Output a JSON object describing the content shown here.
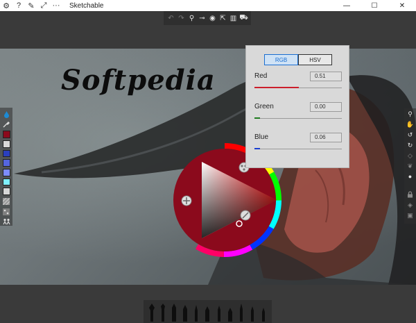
{
  "window": {
    "title": "Sketchable",
    "controls": {
      "minimize": "—",
      "maximize": "☐",
      "close": "✕"
    }
  },
  "titlebar_icons": [
    "settings-icon",
    "help-icon",
    "tools-icon",
    "expand-icon",
    "more-icon"
  ],
  "titlebar_glyphs": {
    "settings": "⚙",
    "help": "?",
    "tools": "✎",
    "expand": "⤢",
    "more": "···"
  },
  "top_toolbar": {
    "icons": [
      "undo-icon",
      "redo-icon",
      "dropper-icon",
      "ruler-icon",
      "eye-icon",
      "export-icon",
      "book-icon",
      "cart-icon"
    ],
    "glyphs": {
      "undo": "↶",
      "redo": "↷",
      "dropper": "⚲",
      "ruler": "⊸",
      "eye": "◉",
      "export": "⇱",
      "book": "▥",
      "cart": "⛟"
    }
  },
  "canvas": {
    "watermark_text": "Softpedia"
  },
  "left_toolbar": {
    "swatches": [
      "#8b0a1c",
      "#d9d9d9",
      "#2a3fbf",
      "#5566e0",
      "#7d8dff",
      "#7ff0ff",
      "#d7d7d7"
    ],
    "colors": {
      "brand_blue": "#1c8ad4"
    }
  },
  "right_toolbar": {
    "icons": [
      "zoom-icon",
      "hand-icon",
      "rotate-ccw-icon",
      "rotate-cw-icon",
      "tag-icon",
      "butterfly-icon",
      "circle-icon",
      "lock-icon",
      "layers-icon",
      "box-icon"
    ],
    "glyphs": {
      "zoom": "⚲",
      "hand": "✋",
      "rotate_ccw": "↺",
      "rotate_cw": "↻",
      "tag": "◇",
      "butterfly": "❦",
      "circle": "●",
      "lock": "🔒",
      "layers": "◈",
      "box": "▣"
    }
  },
  "color_panel": {
    "tabs": [
      {
        "label": "RGB",
        "active": true
      },
      {
        "label": "HSV",
        "active": false
      }
    ],
    "channels": [
      {
        "label": "Red",
        "value": "0.51",
        "fraction": 0.51,
        "color": "#cc1f2c"
      },
      {
        "label": "Green",
        "value": "0.00",
        "fraction": 0.0,
        "color": "#1e7b1e"
      },
      {
        "label": "Blue",
        "value": "0.06",
        "fraction": 0.06,
        "color": "#1a3fd0"
      }
    ]
  },
  "color_wheel": {
    "current_color": "#8b0a1c"
  },
  "bottom_toolbar": {
    "brushes": [
      "brush-1",
      "brush-2",
      "brush-3",
      "brush-4",
      "brush-5",
      "brush-6",
      "brush-7",
      "brush-8",
      "brush-9",
      "brush-10",
      "brush-11"
    ]
  }
}
